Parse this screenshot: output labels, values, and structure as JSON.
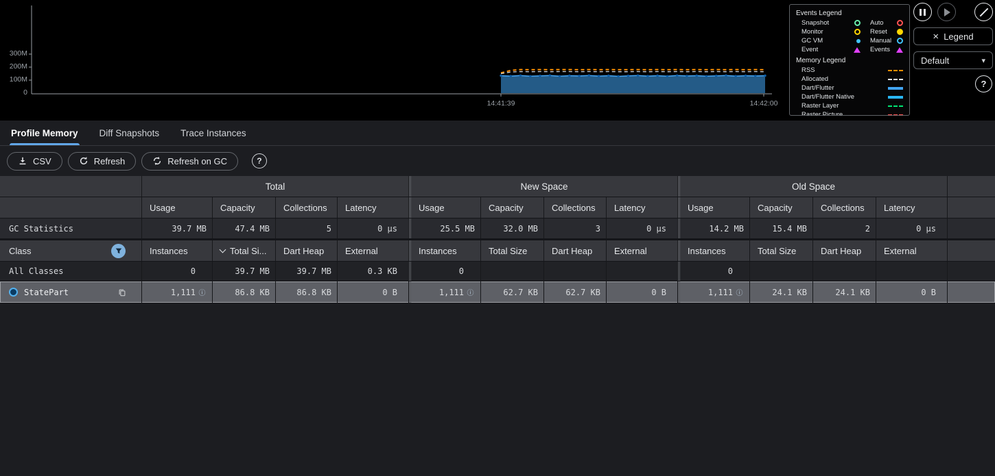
{
  "colors": {
    "accent": "#61a6e8",
    "selected_row": "#5e6066",
    "header_bg": "#37383d",
    "chart_bg": "#000000"
  },
  "icons": {
    "pause-icon": "two vertical bars in circle",
    "play-icon": "play triangle in circle",
    "block-icon": "circle with diagonal slash",
    "close-icon": "×",
    "chevron-down-icon": "▾",
    "help-icon": "?",
    "download-icon": "arrow down into tray",
    "refresh-icon": "circular arrow",
    "filter-icon": "funnel in blue circle",
    "copy-icon": "overlapping squares",
    "info-icon": "ⓘ",
    "sort-descending-icon": "chevron down",
    "class-icon": "blue ring circle"
  },
  "chart": {
    "y_axis_labels": [
      "300M",
      "200M",
      "100M",
      "0"
    ],
    "x_axis_labels": [
      "14:41:39",
      "14:42:00"
    ]
  },
  "chart_data": {
    "type": "area",
    "x_tick_labels": [
      "14:41:39",
      "14:42:00"
    ],
    "y_tick_labels": [
      "0",
      "100M",
      "200M",
      "300M"
    ],
    "ylim": [
      0,
      400
    ],
    "grid": false,
    "legend_position": "floating-top-right",
    "series": [
      {
        "name": "RSS",
        "style": "dashed-line",
        "color": "#ff9100",
        "values": [
          156,
          175,
          181,
          180,
          181,
          180,
          181,
          181,
          180,
          181,
          180,
          181,
          180,
          180,
          181,
          180,
          181,
          180,
          181,
          180,
          181,
          180,
          181,
          180,
          181,
          180,
          181,
          180
        ]
      },
      {
        "name": "Allocated",
        "style": "dashed-line",
        "color": "#d7dadd",
        "values": [
          150,
          162,
          166,
          165,
          166,
          165,
          166,
          166,
          165,
          166,
          165,
          166,
          165,
          165,
          166,
          165,
          166,
          165,
          166,
          165,
          166,
          165,
          166,
          165,
          166,
          165,
          166,
          165
        ]
      },
      {
        "name": "Dart/Flutter",
        "style": "area",
        "color": "#42a5f5",
        "values": [
          134,
          131,
          135,
          130,
          133,
          136,
          130,
          134,
          132,
          136,
          131,
          134,
          129,
          133,
          135,
          131,
          134,
          130,
          135,
          132,
          134,
          130,
          133,
          136,
          131,
          134,
          132,
          134
        ]
      }
    ]
  },
  "legend_panel": {
    "events_title": "Events Legend",
    "events": [
      {
        "label": "Snapshot",
        "shape": "circle-outline",
        "color": "#69f0ae"
      },
      {
        "label": "Auto",
        "shape": "circle-outline",
        "color": "#ff5252"
      },
      {
        "label": "Monitor",
        "shape": "circle-outline",
        "color": "#ffd600"
      },
      {
        "label": "Reset",
        "shape": "circle-filled",
        "color": "#ffd600"
      },
      {
        "label": "GC VM",
        "shape": "dot",
        "color": "#40c4ff"
      },
      {
        "label": "Manual",
        "shape": "circle-outline",
        "color": "#40c4ff"
      },
      {
        "label": "Event",
        "shape": "triangle",
        "color": "#e040fb"
      },
      {
        "label": "Events",
        "shape": "triangle",
        "color": "#e040fb"
      }
    ],
    "memory_title": "Memory Legend",
    "memory": [
      {
        "label": "RSS",
        "shape": "line-dashed",
        "color": "#ff9100"
      },
      {
        "label": "Allocated",
        "shape": "line-dashed",
        "color": "#e6e8ea"
      },
      {
        "label": "Dart/Flutter",
        "shape": "line-solid",
        "color": "#42a5f5"
      },
      {
        "label": "Dart/Flutter Native",
        "shape": "line-solid",
        "color": "#29b6f6"
      },
      {
        "label": "Raster Layer",
        "shape": "line-dashed",
        "color": "#00e676"
      },
      {
        "label": "Raster Picture",
        "shape": "line-dashed",
        "color": "#ff5252"
      }
    ]
  },
  "chart_controls": {
    "legend_button_label": "Legend",
    "interval_value": "Default"
  },
  "tabs": {
    "items": [
      {
        "label": "Profile Memory",
        "selected": true
      },
      {
        "label": "Diff Snapshots",
        "selected": false
      },
      {
        "label": "Trace Instances",
        "selected": false
      }
    ]
  },
  "toolbar": {
    "csv_label": "CSV",
    "refresh_label": "Refresh",
    "refresh_on_gc_label": "Refresh on GC"
  },
  "gc_table": {
    "group_headers": [
      "Total",
      "New Space",
      "Old Space"
    ],
    "column_headers": [
      "Usage",
      "Capacity",
      "Collections",
      "Latency"
    ],
    "row_label": "GC Statistics",
    "total": [
      "39.7 MB",
      "47.4 MB",
      "5",
      "0 μs"
    ],
    "new_space": [
      "25.5 MB",
      "32.0 MB",
      "3",
      "0 μs"
    ],
    "old_space": [
      "14.2 MB",
      "15.4 MB",
      "2",
      "0 μs"
    ]
  },
  "class_table": {
    "class_header": "Class",
    "headers": {
      "instances": "Instances",
      "total_size": "Total Size",
      "total_size_sorted": "Total Si...",
      "dart_heap": "Dart Heap",
      "external": "External"
    },
    "rows": [
      {
        "name": "All Classes",
        "total": [
          "0",
          "39.7 MB",
          "39.7 MB",
          "0.3 KB"
        ],
        "new_space": [
          "0",
          "",
          "",
          ""
        ],
        "old_space": [
          "0",
          "",
          "",
          ""
        ]
      },
      {
        "name": "StatePart",
        "selected": true,
        "total": [
          "1,111",
          "86.8 KB",
          "86.8 KB",
          "0 B"
        ],
        "new_space": [
          "1,111",
          "62.7 KB",
          "62.7 KB",
          "0 B"
        ],
        "old_space": [
          "1,111",
          "24.1 KB",
          "24.1 KB",
          "0 B"
        ]
      }
    ]
  }
}
